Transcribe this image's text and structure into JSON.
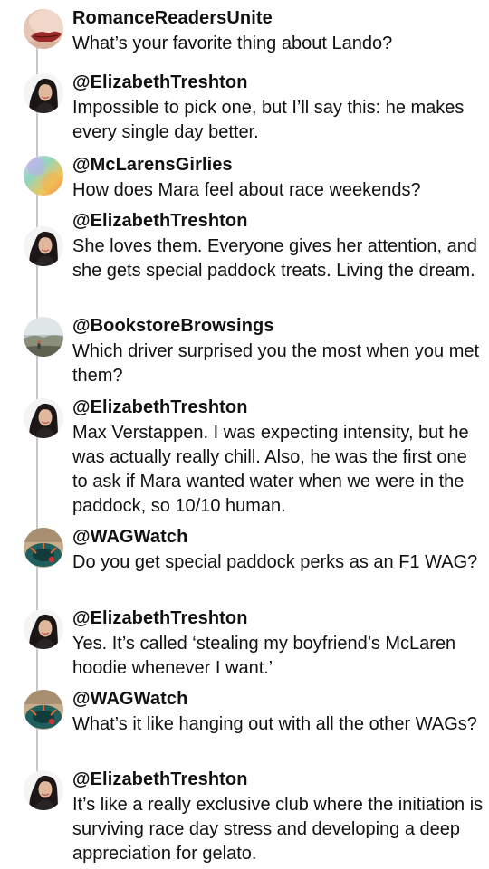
{
  "thread": [
    {
      "avatar": "lips-photo-avatar",
      "handle": "RomanceReadersUnite",
      "text": "What’s your favorite thing about Lando?"
    },
    {
      "avatar": "woman-portrait-avatar",
      "handle": "@ElizabethTreshton",
      "text": "Impossible to pick one, but I’ll say this: he makes every single day better."
    },
    {
      "avatar": "gradient-avatar",
      "handle": "@McLarensGirlies",
      "text": "How does Mara feel about race weekends?"
    },
    {
      "avatar": "woman-portrait-avatar",
      "handle": "@ElizabethTreshton",
      "text": "She loves them. Everyone gives her attention, and she gets special paddock treats. Living the dream."
    },
    {
      "avatar": "landscape-avatar",
      "handle": "@BookstoreBrowsings",
      "text": "Which driver surprised you the most when you met them?"
    },
    {
      "avatar": "woman-portrait-avatar",
      "handle": "@ElizabethTreshton",
      "text": "Max Verstappen. I was expecting intensity, but he was actually really chill. Also, he was the first one to ask if Mara wanted water when we were in the paddock, so 10/10 human."
    },
    {
      "avatar": "car-wheel-avatar",
      "handle": "@WAGWatch",
      "text": "Do you get special paddock perks as an F1 WAG?"
    },
    {
      "avatar": "woman-portrait-avatar",
      "handle": "@ElizabethTreshton",
      "text": "Yes. It’s called ‘stealing my boyfriend’s McLaren hoodie whenever I want.’"
    },
    {
      "avatar": "car-wheel-avatar",
      "handle": "@WAGWatch",
      "text": "What’s it like hanging out with all the other WAGs?"
    },
    {
      "avatar": "woman-portrait-avatar",
      "handle": "@ElizabethTreshton",
      "text": "It’s like a really exclusive club where the initiation is surviving race day stress and developing a deep appreciation for gelato."
    }
  ]
}
